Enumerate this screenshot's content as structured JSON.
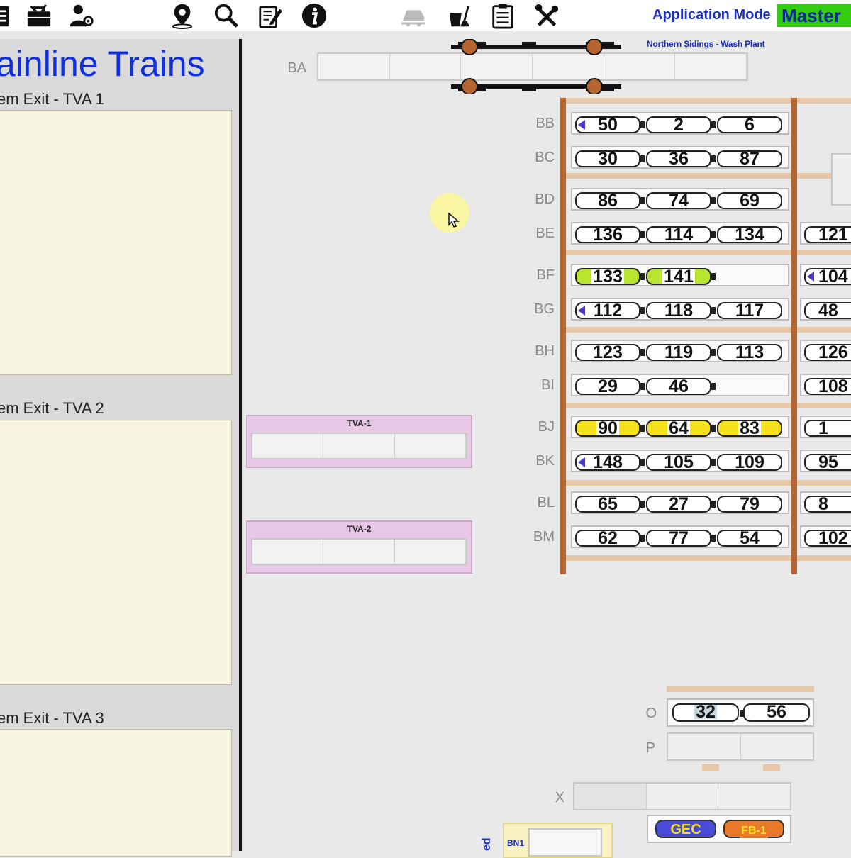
{
  "toolbar": {
    "mode_label": "Application Mode",
    "mode_value": "Master",
    "icons": [
      "clipboard-icon",
      "toolbox-icon",
      "user-settings-icon",
      "map-pin-icon",
      "search-icon",
      "edit-notes-icon",
      "info-icon",
      "train-icon",
      "cleaning-icon",
      "checklist-icon",
      "tools-icon"
    ]
  },
  "left_panel": {
    "title": "ainline Trains",
    "exits": [
      {
        "label": "em Exit - TVA 1"
      },
      {
        "label": "em Exit - TVA 2"
      },
      {
        "label": "em Exit - TVA 3"
      }
    ]
  },
  "northern_label": "Northern Sidings - Wash Plant",
  "tracks": {
    "BA": "BA",
    "rows": [
      {
        "id": "BB",
        "wagons": [
          {
            "n": "50",
            "cap": "blue"
          },
          {
            "n": "2"
          },
          {
            "n": "6"
          }
        ]
      },
      {
        "id": "BC",
        "wagons": [
          {
            "n": "30"
          },
          {
            "n": "36"
          },
          {
            "n": "87"
          }
        ]
      },
      {
        "id": "BD",
        "wagons": [
          {
            "n": "86"
          },
          {
            "n": "74"
          },
          {
            "n": "69"
          }
        ]
      },
      {
        "id": "BE",
        "wagons": [
          {
            "n": "136"
          },
          {
            "n": "114"
          },
          {
            "n": "134"
          }
        ],
        "right": {
          "n": "121"
        }
      },
      {
        "id": "BF",
        "wagons": [
          {
            "n": "133",
            "color": "green"
          },
          {
            "n": "141",
            "color": "green"
          }
        ],
        "right": {
          "n": "104",
          "cap": "blue"
        }
      },
      {
        "id": "BG",
        "wagons": [
          {
            "n": "112",
            "cap": "blue"
          },
          {
            "n": "118"
          },
          {
            "n": "117"
          }
        ],
        "right": {
          "n": "48"
        }
      },
      {
        "id": "BH",
        "wagons": [
          {
            "n": "123"
          },
          {
            "n": "119"
          },
          {
            "n": "113"
          }
        ],
        "right": {
          "n": "126"
        }
      },
      {
        "id": "BI",
        "wagons": [
          {
            "n": "29"
          },
          {
            "n": "46"
          }
        ],
        "right": {
          "n": "108"
        }
      },
      {
        "id": "BJ",
        "wagons": [
          {
            "n": "90",
            "color": "yellow"
          },
          {
            "n": "64",
            "color": "yellow"
          },
          {
            "n": "83",
            "color": "yellow"
          }
        ],
        "right": {
          "n": "1"
        }
      },
      {
        "id": "BK",
        "wagons": [
          {
            "n": "148",
            "cap": "blue"
          },
          {
            "n": "105"
          },
          {
            "n": "109"
          }
        ],
        "right": {
          "n": "95"
        }
      },
      {
        "id": "BL",
        "wagons": [
          {
            "n": "65"
          },
          {
            "n": "27"
          },
          {
            "n": "79"
          }
        ],
        "right": {
          "n": "8"
        }
      },
      {
        "id": "BM",
        "wagons": [
          {
            "n": "62"
          },
          {
            "n": "77"
          },
          {
            "n": "54"
          }
        ],
        "right": {
          "n": "102"
        }
      }
    ]
  },
  "tva1": {
    "title": "TVA-1"
  },
  "tva2": {
    "title": "TVA-2"
  },
  "lower": {
    "O": {
      "label": "O",
      "wagons": [
        "32",
        "56"
      ]
    },
    "P": {
      "label": "P"
    },
    "X": {
      "label": "X"
    },
    "gec": "GEC",
    "fb1": "FB-1",
    "bn1": "BN1",
    "vertical": "ed"
  },
  "colors": {
    "accent_blue": "#1030e0",
    "master_green": "#33cc11",
    "rail_brown": "#b5652f",
    "wagon_yellow": "#f5e21d",
    "wagon_green": "#b8e62e",
    "tva_pink": "#e8c8e6"
  }
}
